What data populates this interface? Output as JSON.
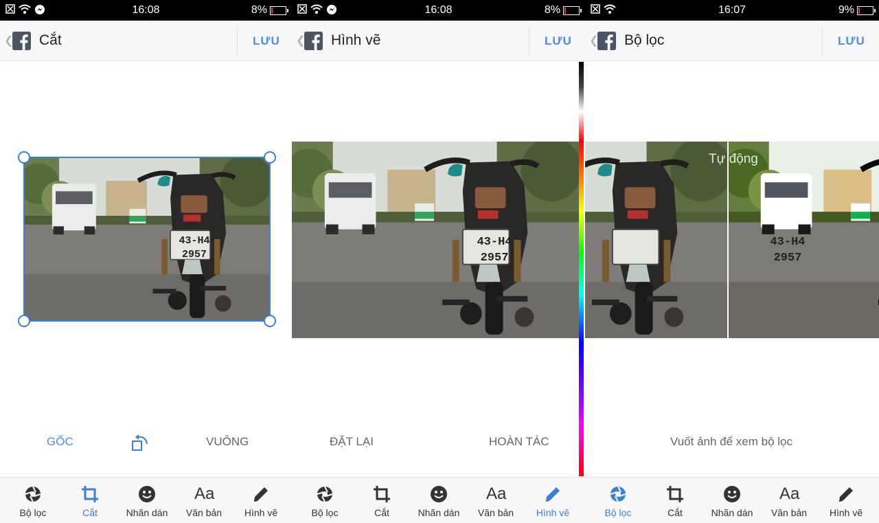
{
  "screens": [
    {
      "status": {
        "time": "16:08",
        "battery": "8%",
        "battery_level": 0.08
      },
      "header": {
        "title": "Cắt",
        "save_label": "LƯU"
      },
      "actions": {
        "original": "GỐC",
        "square": "VUÔNG"
      },
      "nav_active": "crop"
    },
    {
      "status": {
        "time": "16:08",
        "battery": "8%",
        "battery_level": 0.08
      },
      "header": {
        "title": "Hình vẽ",
        "save_label": "LƯU"
      },
      "actions": {
        "reset": "ĐẶT LẠI",
        "undo": "HOÀN TÁC"
      },
      "nav_active": "draw"
    },
    {
      "status": {
        "time": "16:07",
        "battery": "9%",
        "battery_level": 0.09
      },
      "header": {
        "title": "Bộ lọc",
        "save_label": "LƯU"
      },
      "filter_name": "Tự động",
      "hint": "Vuốt ảnh để xem bộ lọc",
      "nav_active": "filter"
    }
  ],
  "plate": {
    "line1": "43-H4",
    "line2": "2957"
  },
  "nav": {
    "filter": "Bộ lọc",
    "crop": "Cắt",
    "stickers": "Nhãn dán",
    "text": "Văn bản",
    "draw": "Hình vẽ",
    "text_icon": "Aa"
  },
  "colors": {
    "accent": "#3b7fd9",
    "save": "#4a90e2"
  }
}
